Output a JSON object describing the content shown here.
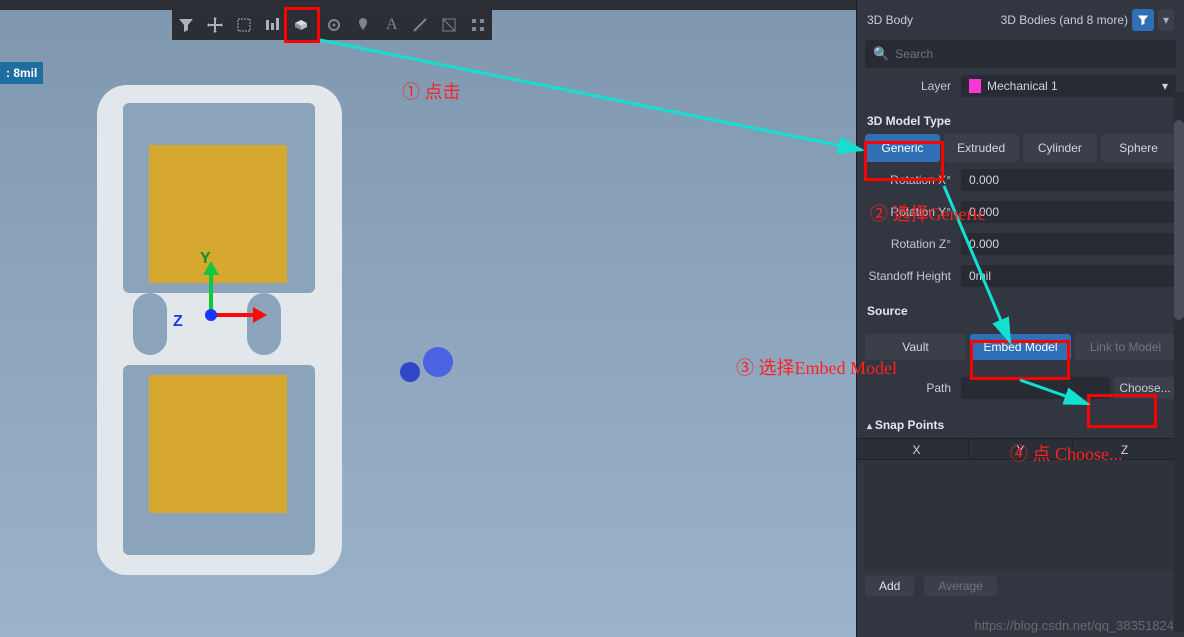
{
  "leftpill": ": 8mil",
  "toolbar": {
    "tools": [
      "filter",
      "move",
      "selrect",
      "align",
      "body3d",
      "sep",
      "origin",
      "pin",
      "text",
      "line",
      "dimension",
      "array"
    ]
  },
  "axis": {
    "x": "X",
    "y": "Y",
    "z": "Z"
  },
  "panel": {
    "title_left": "3D Body",
    "title_right": "3D Bodies (and 8 more)",
    "search_placeholder": "Search",
    "layer_label": "Layer",
    "layer_value": "Mechanical 1",
    "section_model_type": "3D Model Type",
    "model_types": [
      "Generic",
      "Extruded",
      "Cylinder",
      "Sphere"
    ],
    "rotation_x_label": "Rotation X°",
    "rotation_x_value": "0.000",
    "rotation_y_label": "Rotation Y°",
    "rotation_y_value": "0.000",
    "rotation_z_label": "Rotation Z°",
    "rotation_z_value": "0.000",
    "standoff_label": "Standoff Height",
    "standoff_value": "0mil",
    "section_source": "Source",
    "sources": [
      "Vault",
      "Embed Model",
      "Link to Model"
    ],
    "path_label": "Path",
    "choose_label": "Choose...",
    "snap_title": "Snap Points",
    "snap_cols": [
      "X",
      "Y",
      "Z"
    ],
    "snap_add": "Add",
    "snap_avg": "Average"
  },
  "annotations": {
    "a1": "① 点击",
    "a2": "② 选择Generic",
    "a3": "③ 选择Embed Model",
    "a4": "④ 点 Choose..."
  },
  "watermark": "https://blog.csdn.net/qq_38351824"
}
